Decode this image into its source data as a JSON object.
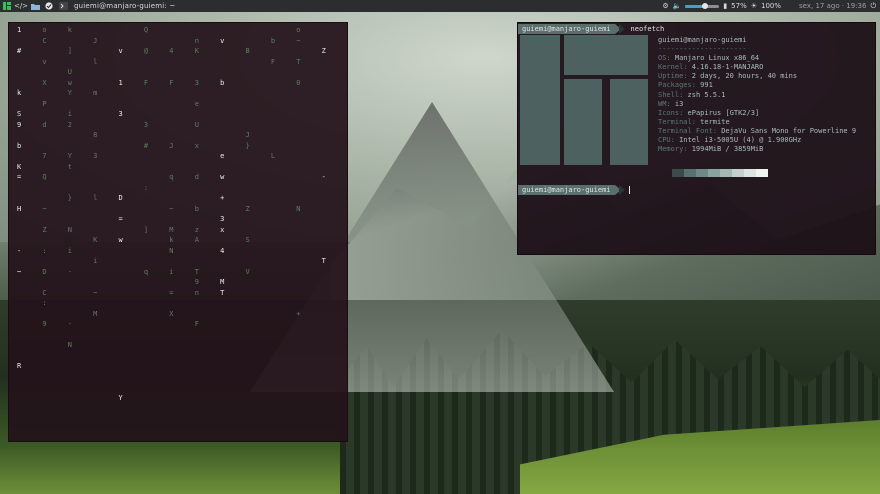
{
  "panel": {
    "window_title": "guiemi@manjaro-guiemi: ~",
    "volume_percent": 57,
    "volume_label": "57%",
    "battery_label": "100%",
    "brightness_percent": 100,
    "datetime": "sex, 17 ago · 19:36",
    "icons": [
      "app-menu-icon",
      "code-icon",
      "folder-icon",
      "browser-icon",
      "terminal-icon"
    ]
  },
  "neofetch": {
    "prompt_user": "guiemi@manjaro-guiemi",
    "command": "neofetch",
    "user_host": "guiemi@manjaro-guiemi",
    "separator": "---------------------",
    "lines": [
      {
        "key": "OS:",
        "value": "Manjaro Linux x86_64"
      },
      {
        "key": "Kernel:",
        "value": "4.16.18-1-MANJARO"
      },
      {
        "key": "Uptime:",
        "value": "2 days, 20 hours, 40 mins"
      },
      {
        "key": "Packages:",
        "value": "991"
      },
      {
        "key": "Shell:",
        "value": "zsh 5.5.1"
      },
      {
        "key": "WM:",
        "value": "i3"
      },
      {
        "key": "Icons:",
        "value": "ePapirus [GTK2/3]"
      },
      {
        "key": "Terminal:",
        "value": "termite"
      },
      {
        "key": "Terminal Font:",
        "value": "DejaVu Sans Mono for Powerline 9"
      },
      {
        "key": "CPU:",
        "value": "Intel i3-5005U (4) @ 1.900GHz"
      },
      {
        "key": "Memory:",
        "value": "1994MiB / 3859MiB"
      }
    ],
    "palette_colors": [
      "#3b4b4b",
      "#587070",
      "#6e8a88",
      "#8aa39f",
      "#a4b7b3",
      "#c3d0cc",
      "#dbe4e0",
      "#eef3f0"
    ],
    "prompt2_user": "guiemi@manjaro-guiemi"
  },
  "matrix": {
    "columns": [
      "1\n\n#\n\n\n\nk\n\nS\n9\n\nb\n\nK\n=\n\n\nH\n\n\n\n-\n\n~\n\n\n\n\n\n\n\n\nR\n",
      "o\nC\n\nv\n\nX\n\nP\n\nd\n\n\n7\n\nQ\n\n\n~\n\nZ\n\n:\n\nD\n\nC\n:\n\n9\n",
      "k\n\n]\n\nU\nw\nY\n\ni\n2\n\n\nY\nt\n\n\n}\n\n\nN\n\ni\n\n-\n\n\n\n\n-\n\nN\n",
      "\nJ\n\nl\n\n\nm\n\n\n\n8\n\n3\n\n\n\nl\n\n\n\nK\n\ni\n\n\n~\n\nM\n",
      "\n\nv\n\n\n1\n\n\n3\n\n\n\n\n\n\n\nD\n\n=\n\nw\n\n\n\n\n\n\n\n\n\n\n\n\n\n\nY",
      "Q\n\n@\n\n\nF\n\n\n\n3\n\n#\n\n\n\n:\n\n\n\n]\n\n\n\nq\n\n\n\n\n\n\n",
      "\n\n4\n\n\nF\n\n\n\n\n\nJ\n\n\nq\n\n\n~\n\nM\nk\nN\n\ni\n\n=\n\nX\n\n",
      "\nn\nK\n\n\n3\n\ne\n\nU\n\nx\n\n\nd\n\n\nb\n\nz\nA\n\n\nT\n9\nn\n\n\nF\n",
      "\nv\n\n\n\nb\n\n\n\n\n\n\ne\n\nw\n\n+\n\n3\nx\n\n4\n\n\nM\nT\n\n\n\n\n",
      "\n\nB\n\n\n\n\n\n\n\nJ\n}\n\n\n\n\n\nZ\n\n\nS\n\n\nV\n\n\n",
      "\nb\n\nF\n\n\n\n\n\n\n\n\nL\n\n\n\n\n\n\n\n\n\n\n\n\n\n",
      "o\n~\n\nT\n\n0\n\n\n\n\n\n\n\n\n\n\n\nN\n\n\n\n\n\n\n\n\n\n+\n\n\n",
      "\n\nZ\n\n\n\n\n\n\n\n\n\n\n\n-\n\n\n\n\n\n\n\nT\n\n\n\n"
    ]
  }
}
